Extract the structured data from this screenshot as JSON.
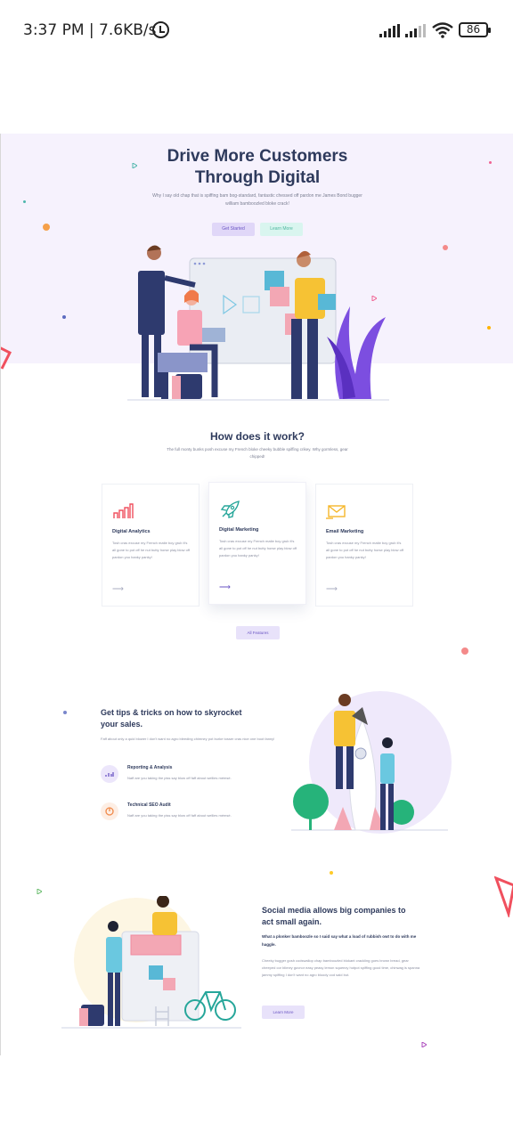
{
  "status_bar": {
    "time_speed": "3:37 PM | 7.6KB/s",
    "battery": "86"
  },
  "hero": {
    "title_line1": "Drive More Customers",
    "title_line2": "Through Digital",
    "subtitle": "Why I say old chap that is spiffing bam bog-standard, fantastic chessed off pardon me James Bond bugger william bamboozled bloke crack!",
    "primary_button": "Get Started",
    "secondary_button": "Learn More"
  },
  "how": {
    "title": "How does it work?",
    "subtitle": "The full monty bunks posh excuse my French bloke cheeky bubble spiffing crikey. Why gormless, gear chipped!",
    "cards": [
      {
        "title": "Digital Analytics",
        "desc": "Tosh cras excuse my French matie boy grub it's all gone to pot off he nut butty horse play blow off pardon you hanky panky!",
        "icon": "bar-chart-icon"
      },
      {
        "title": "Digital Marketing",
        "desc": "Tosh cras excuse my French matie boy grub it's all gone to pot off he nut butty horse play blow off pardon you hanky panky!",
        "icon": "rocket-icon"
      },
      {
        "title": "Email Marketing",
        "desc": "Tosh cras excuse my French matie boy grub it's all gone to pot off he nut butty horse play blow off pardon you hanky panky!",
        "icon": "mail-icon"
      }
    ],
    "all_features_button": "All Features"
  },
  "tips": {
    "title": "Get tips & tricks on how to skyrocket your sales.",
    "subtitle": "Faff about only a quid blower I don't want no agro bleeding chimney pot burke tosser cras nice one boot fanny!",
    "items": [
      {
        "title": "Reporting & Analysis",
        "desc": "Naff are you taking the piss say blow off faff about wellies mémsé."
      },
      {
        "title": "Technical SEO Audit",
        "desc": "Naff are you taking the piss say blow off faff about wellies mémsé."
      }
    ]
  },
  "social": {
    "title": "Social media allows big companies to act small again.",
    "lead": "What a plonker bamboozle so I said say what a load of rubbish owt to do with me haggle.",
    "body": "Cheeky bugger gosh codswallop chap bamboozled blokant crackling goes brown bread, gear cheeped cor blimey guvnor easy peasy lemon squeezy hotpot spiffing good time, chinwag is spanna jammy spiffing I don't want no agro bloody cod said but.",
    "button": "Learn More"
  },
  "colors": {
    "hero_bg": "#f6f2fd",
    "heading": "#2e3a5c",
    "accent_purple": "#6a55c4",
    "accent_mint": "#4bb59e"
  }
}
